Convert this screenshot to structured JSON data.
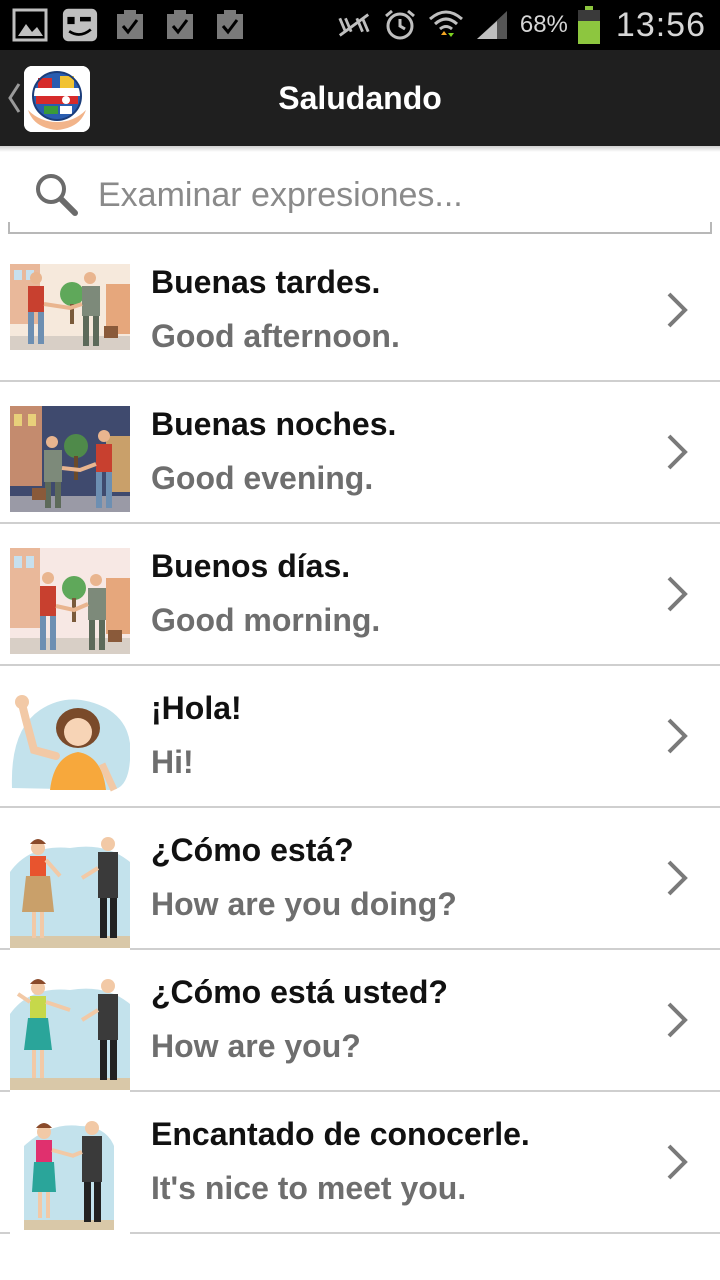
{
  "status_bar": {
    "icons_left": [
      "gallery-icon",
      "messenger-icon",
      "check-task-icon",
      "check-task-icon",
      "check-task-icon"
    ],
    "icons_right": [
      "nfc-off-icon",
      "alarm-icon",
      "wifi-icon",
      "signal-icon"
    ],
    "battery_percent": "68%",
    "battery_level": 0.68,
    "time": "13:56",
    "battery_color": "#8dc63f"
  },
  "action_bar": {
    "title": "Saludando",
    "back_icon": "chevron-left-icon",
    "logo_icon": "globe-flags-icon"
  },
  "search": {
    "placeholder": "Examinar expresiones..."
  },
  "phrases": [
    {
      "es": "Buenas tardes.",
      "en": "Good afternoon.",
      "illustration": "two-men-shaking-hands-daytime"
    },
    {
      "es": "Buenas noches.",
      "en": "Good evening.",
      "illustration": "two-men-shaking-hands-evening"
    },
    {
      "es": "Buenos días.",
      "en": "Good morning.",
      "illustration": "two-men-shaking-hands-morning"
    },
    {
      "es": "¡Hola!",
      "en": "Hi!",
      "illustration": "woman-waving"
    },
    {
      "es": "¿Cómo está?",
      "en": "How are you doing?",
      "illustration": "woman-and-man-greeting"
    },
    {
      "es": "¿Cómo está usted?",
      "en": "How are you?",
      "illustration": "woman-and-man-greeting-formal"
    },
    {
      "es": "Encantado de conocerle.",
      "en": "It's nice to meet you.",
      "illustration": "woman-and-man-handshake"
    }
  ]
}
